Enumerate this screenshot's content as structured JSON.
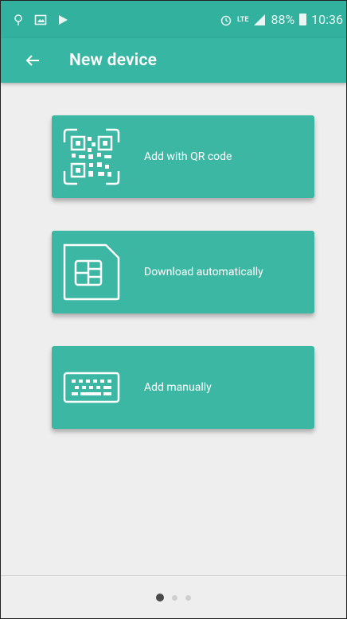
{
  "statusbar": {
    "battery": "88%",
    "time": "10:36",
    "network": "LTE",
    "icons": [
      "usb-icon",
      "image-icon",
      "play-store-icon",
      "alarm-icon",
      "lte-icon",
      "signal-icon",
      "battery-icon"
    ]
  },
  "appbar": {
    "title": "New device",
    "back_icon": "arrow-left-icon"
  },
  "options": [
    {
      "label": "Add with QR code",
      "icon": "qr-code-icon"
    },
    {
      "label": "Download automatically",
      "icon": "sim-card-icon"
    },
    {
      "label": "Add manually",
      "icon": "keyboard-icon"
    }
  ],
  "pager": {
    "current": 1,
    "total": 3
  },
  "colors": {
    "primary": "#37b6a3",
    "card": "#3cb7a3",
    "background": "#eeeeee"
  }
}
